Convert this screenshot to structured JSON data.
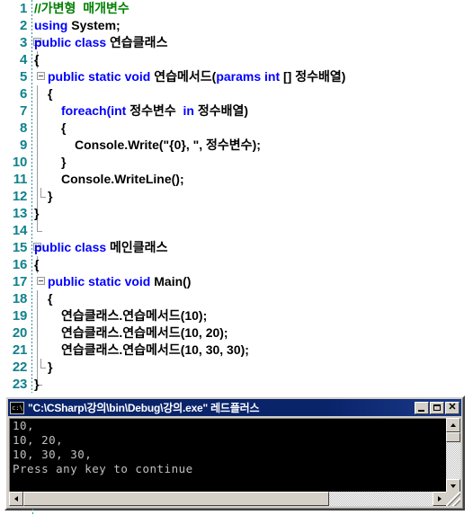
{
  "editor": {
    "lines": [
      {
        "n": "1",
        "indent": 0,
        "fold": "none",
        "segments": [
          {
            "t": "//가변형  매개변수",
            "c": "cmt"
          }
        ]
      },
      {
        "n": "2",
        "indent": 0,
        "fold": "none",
        "segments": [
          {
            "t": "using ",
            "c": "kw"
          },
          {
            "t": "System;",
            "c": "txt"
          }
        ]
      },
      {
        "n": "3",
        "indent": 0,
        "fold": "box",
        "segments": [
          {
            "t": "public class ",
            "c": "kw"
          },
          {
            "t": "연습클래스",
            "c": "txt"
          }
        ]
      },
      {
        "n": "4",
        "indent": 0,
        "fold": "line",
        "segments": [
          {
            "t": "{",
            "c": "txt"
          }
        ]
      },
      {
        "n": "5",
        "indent": 1,
        "fold": "box2",
        "segments": [
          {
            "t": "public static void ",
            "c": "kw"
          },
          {
            "t": "연습메서드(",
            "c": "txt"
          },
          {
            "t": "params int ",
            "c": "kw"
          },
          {
            "t": "[] 정수배열)",
            "c": "txt"
          }
        ]
      },
      {
        "n": "6",
        "indent": 1,
        "fold": "line",
        "segments": [
          {
            "t": "{",
            "c": "txt"
          }
        ]
      },
      {
        "n": "7",
        "indent": 2,
        "fold": "line",
        "segments": [
          {
            "t": "foreach(int ",
            "c": "kw"
          },
          {
            "t": "정수변수  ",
            "c": "txt"
          },
          {
            "t": "in ",
            "c": "kw"
          },
          {
            "t": "정수배열)",
            "c": "txt"
          }
        ]
      },
      {
        "n": "8",
        "indent": 2,
        "fold": "line",
        "segments": [
          {
            "t": "{",
            "c": "txt"
          }
        ]
      },
      {
        "n": "9",
        "indent": 3,
        "fold": "line",
        "segments": [
          {
            "t": "Console.Write(\"{0}, \", 정수변수);",
            "c": "txt"
          }
        ]
      },
      {
        "n": "10",
        "indent": 2,
        "fold": "line",
        "segments": [
          {
            "t": "}",
            "c": "txt"
          }
        ]
      },
      {
        "n": "11",
        "indent": 2,
        "fold": "line",
        "segments": [
          {
            "t": "Console.WriteLine();",
            "c": "txt"
          }
        ]
      },
      {
        "n": "12",
        "indent": 1,
        "fold": "end2",
        "segments": [
          {
            "t": "}",
            "c": "txt"
          }
        ]
      },
      {
        "n": "13",
        "indent": 0,
        "fold": "line",
        "segments": [
          {
            "t": "}",
            "c": "txt"
          }
        ]
      },
      {
        "n": "14",
        "indent": 0,
        "fold": "end",
        "segments": []
      },
      {
        "n": "15",
        "indent": 0,
        "fold": "box",
        "segments": [
          {
            "t": "public class ",
            "c": "kw"
          },
          {
            "t": "메인클래스",
            "c": "txt"
          }
        ]
      },
      {
        "n": "16",
        "indent": 0,
        "fold": "line",
        "segments": [
          {
            "t": "{",
            "c": "txt"
          }
        ]
      },
      {
        "n": "17",
        "indent": 1,
        "fold": "box2",
        "segments": [
          {
            "t": "public static void ",
            "c": "kw"
          },
          {
            "t": "Main()",
            "c": "txt"
          }
        ]
      },
      {
        "n": "18",
        "indent": 1,
        "fold": "line",
        "segments": [
          {
            "t": "{",
            "c": "txt"
          }
        ]
      },
      {
        "n": "19",
        "indent": 2,
        "fold": "line",
        "segments": [
          {
            "t": "연습클래스.연습메서드(10);",
            "c": "txt"
          }
        ]
      },
      {
        "n": "20",
        "indent": 2,
        "fold": "line",
        "segments": [
          {
            "t": "연습클래스.연습메서드(10, 20);",
            "c": "txt"
          }
        ]
      },
      {
        "n": "21",
        "indent": 2,
        "fold": "line",
        "segments": [
          {
            "t": "연습클래스.연습메서드(10, 30, 30);",
            "c": "txt"
          }
        ]
      },
      {
        "n": "22",
        "indent": 1,
        "fold": "end2",
        "segments": [
          {
            "t": "}",
            "c": "txt"
          }
        ]
      },
      {
        "n": "23",
        "indent": 0,
        "fold": "end",
        "segments": [
          {
            "t": "}",
            "c": "txt"
          }
        ]
      }
    ],
    "colors": {
      "keyword": "#0000ff",
      "comment": "#008000",
      "text": "#000000",
      "line_number": "#10828c",
      "background": "#ffffff"
    }
  },
  "console": {
    "title": "\"C:\\CSharp\\강의\\bin\\Debug\\강의.exe\" 레드플러스",
    "icon_name": "console-icon",
    "buttons": {
      "minimize": "_",
      "maximize": "□",
      "close": "✕"
    },
    "output_lines": [
      "10,",
      "10, 20,",
      "10, 30, 30,",
      "Press any key to continue"
    ],
    "colors": {
      "titlebar": "#0a246a",
      "title_text": "#ffffff",
      "screen_bg": "#000000",
      "screen_text": "#c0c0c0",
      "chrome": "#d4d0c8"
    }
  }
}
